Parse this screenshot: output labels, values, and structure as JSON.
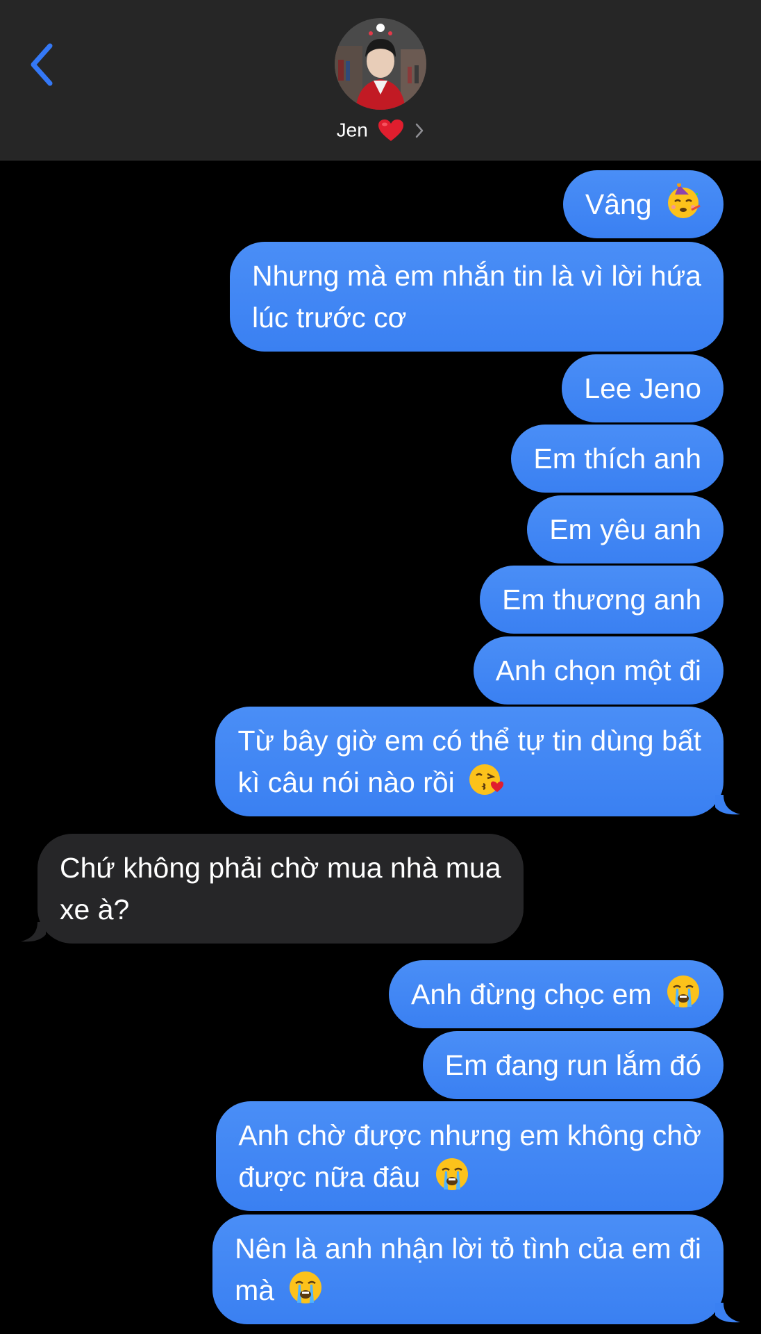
{
  "header": {
    "contact_name": "Jen",
    "name_emoji": "❤️"
  },
  "colors": {
    "sent_bubble": "#3b82f6",
    "received_bubble": "#262628",
    "accent": "#3478f6",
    "header_bg": "#262626"
  },
  "messages": [
    {
      "side": "sent",
      "lines": [
        "Vâng"
      ],
      "emoji": "partying-face"
    },
    {
      "side": "sent",
      "lines": [
        "Nhưng mà em nhắn tin là vì lời hứa",
        "lúc trước cơ"
      ]
    },
    {
      "side": "sent",
      "lines": [
        "Lee Jeno"
      ]
    },
    {
      "side": "sent",
      "lines": [
        "Em thích anh"
      ]
    },
    {
      "side": "sent",
      "lines": [
        "Em yêu anh"
      ]
    },
    {
      "side": "sent",
      "lines": [
        "Em thương anh"
      ]
    },
    {
      "side": "sent",
      "lines": [
        "Anh chọn một đi"
      ]
    },
    {
      "side": "sent",
      "lines": [
        "Từ bây giờ em có thể tự tin dùng bất",
        "kì câu nói nào rồi"
      ],
      "emoji": "kissing-heart-face"
    },
    {
      "side": "received",
      "lines": [
        "Chứ không phải chờ mua nhà mua",
        "xe à?"
      ]
    },
    {
      "side": "sent",
      "lines": [
        "Anh đừng chọc em"
      ],
      "emoji": "crying-face"
    },
    {
      "side": "sent",
      "lines": [
        "Em đang run lắm đó"
      ]
    },
    {
      "side": "sent",
      "lines": [
        "Anh chờ được nhưng em không chờ",
        "được nữa đâu"
      ],
      "emoji": "crying-face"
    },
    {
      "side": "sent",
      "lines": [
        "Nên là anh nhận lời tỏ tình của em đi",
        "mà"
      ],
      "emoji": "crying-face"
    }
  ]
}
